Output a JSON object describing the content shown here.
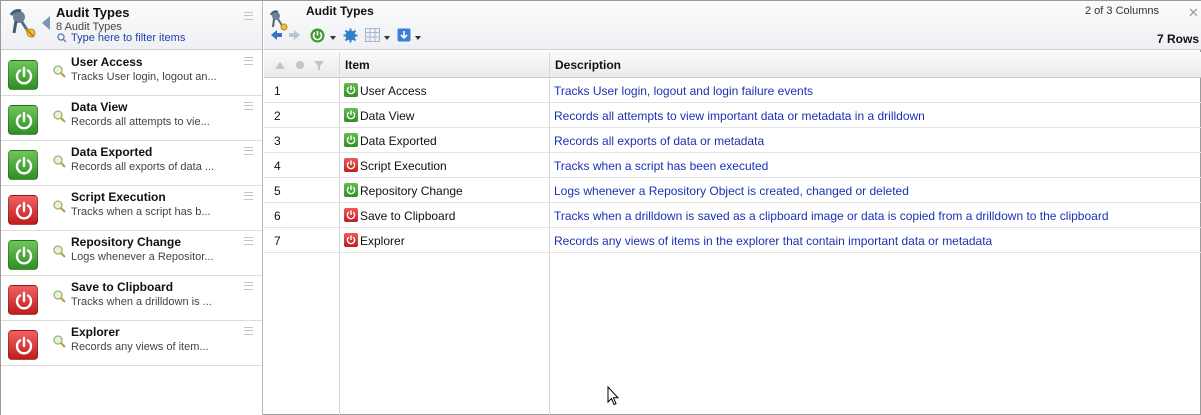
{
  "left_panel": {
    "title": "Audit Types",
    "count": "8 Audit Types",
    "filter_placeholder": "Type here to filter items",
    "items": [
      {
        "title": "User Access",
        "desc": "Tracks User login, logout an...",
        "status": "on"
      },
      {
        "title": "Data View",
        "desc": "Records all attempts to vie...",
        "status": "on"
      },
      {
        "title": "Data Exported",
        "desc": "Records all exports of data ...",
        "status": "on"
      },
      {
        "title": "Script Execution",
        "desc": "Tracks when a script has b...",
        "status": "off"
      },
      {
        "title": "Repository Change",
        "desc": "Logs whenever a Repositor...",
        "status": "on"
      },
      {
        "title": "Save to Clipboard",
        "desc": "Tracks when a drilldown is ...",
        "status": "off"
      },
      {
        "title": "Explorer",
        "desc": "Records any views of item...",
        "status": "off"
      }
    ]
  },
  "right_panel": {
    "title": "Audit Types",
    "column_count": "2 of 3 Columns",
    "rows_count": "7 Rows",
    "toolbar_icons": [
      "back-arrow-icon",
      "forward-arrow-icon",
      "power-icon",
      "gear-icon",
      "grid-icon",
      "export-icon"
    ],
    "headers": {
      "item": "Item",
      "description": "Description"
    },
    "rows": [
      {
        "num": "1",
        "item": "User Access",
        "status": "on",
        "desc": "Tracks User login, logout and login failure events"
      },
      {
        "num": "2",
        "item": "Data View",
        "status": "on",
        "desc": "Records all attempts to view important data or metadata in a drilldown"
      },
      {
        "num": "3",
        "item": "Data Exported",
        "status": "on",
        "desc": "Records all exports of data or metadata"
      },
      {
        "num": "4",
        "item": "Script Execution",
        "status": "off",
        "desc": "Tracks when a script has been executed"
      },
      {
        "num": "5",
        "item": "Repository Change",
        "status": "on",
        "desc": "Logs whenever a Repository Object is created, changed or deleted"
      },
      {
        "num": "6",
        "item": "Save to Clipboard",
        "status": "off",
        "desc": "Tracks when a drilldown is saved as a clipboard image or data is copied from a drilldown to the clipboard"
      },
      {
        "num": "7",
        "item": "Explorer",
        "status": "off",
        "desc": "Records any views of items in the explorer that contain important data or metadata"
      }
    ]
  },
  "colors": {
    "enabled": "#2f8f25",
    "disabled": "#c11d1d",
    "link": "#1a32b5",
    "filter_text": "#1f3fa8"
  }
}
